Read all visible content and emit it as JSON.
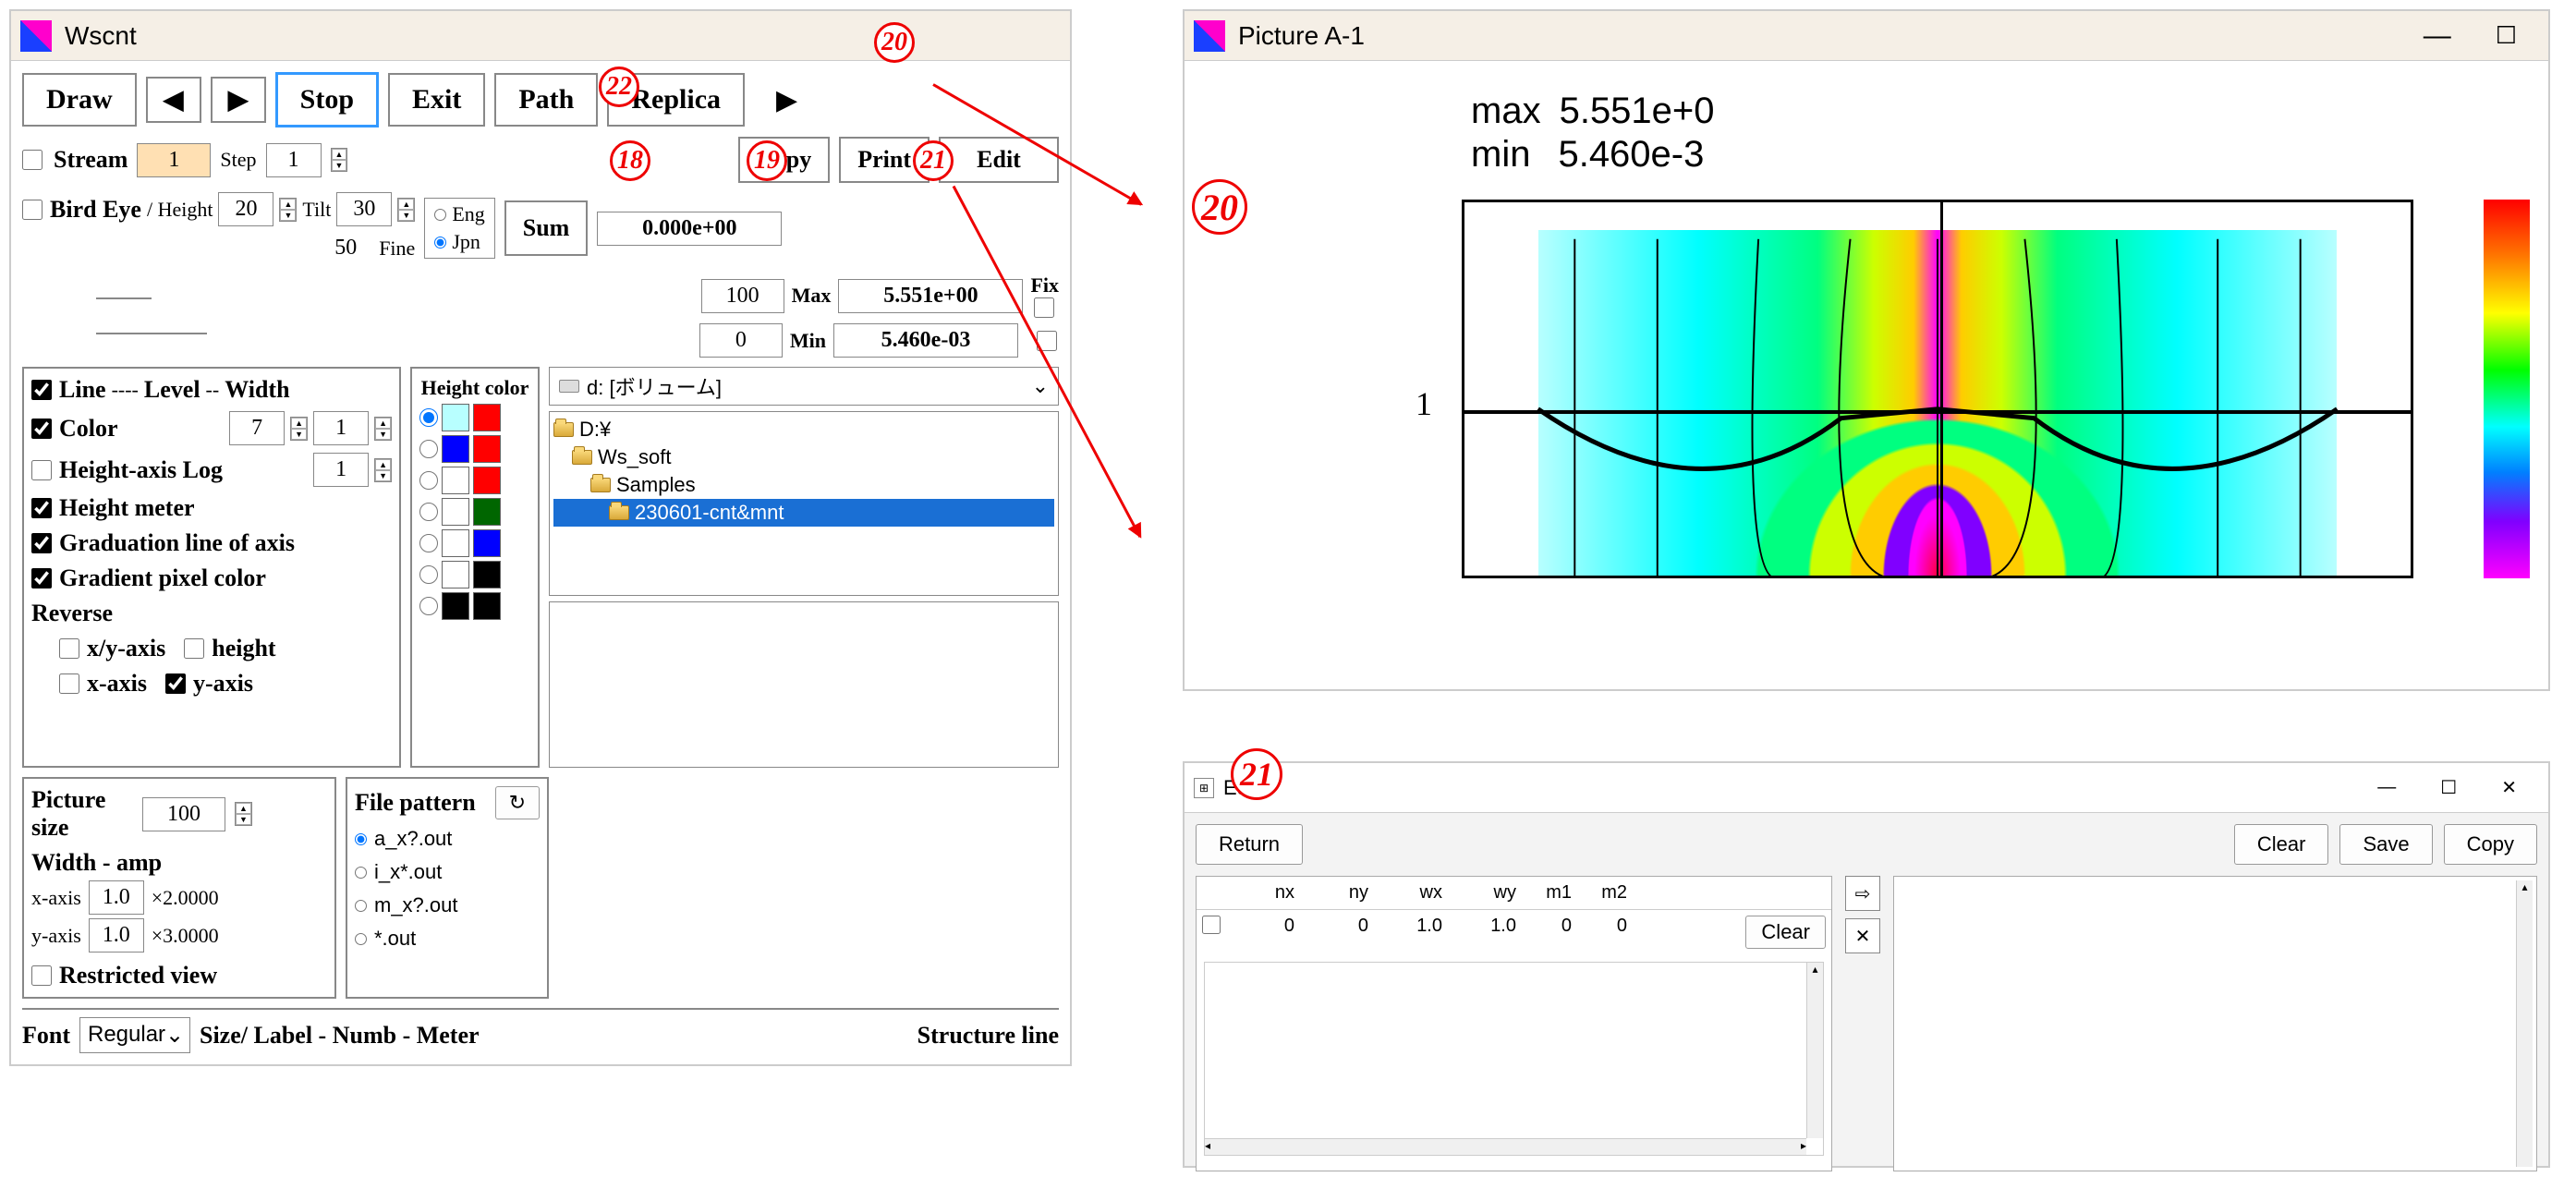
{
  "wscnt": {
    "title": "Wscnt",
    "toolbar1": {
      "draw": "Draw",
      "stop": "Stop",
      "exit": "Exit",
      "path": "Path",
      "replica": "Replica"
    },
    "toolbar2": {
      "copy": "Copy",
      "print": "Print",
      "edit": "Edit"
    },
    "stream": {
      "label": "Stream",
      "value": "1",
      "step_label": "Step",
      "step_value": "1"
    },
    "bird": {
      "label": "Bird Eye",
      "height_label": "/ Height",
      "height_value": "20",
      "tilt_label": "Tilt",
      "tilt_value": "30"
    },
    "fine": {
      "value": "50",
      "label": "Fine"
    },
    "lang": {
      "eng": "Eng",
      "jpn": "Jpn"
    },
    "sum": {
      "label": "Sum",
      "value": "0.000e+00"
    },
    "range": {
      "fix_label": "Fix",
      "max_scale": "100",
      "max_label": "Max",
      "max_value": "5.551e+00",
      "min_scale": "0",
      "min_label": "Min",
      "min_value": "5.460e-03"
    },
    "line_panel": {
      "line": "Line",
      "level": "Level",
      "width": "Width",
      "color": "Color",
      "color_val": "7",
      "color_w": "1",
      "height_axis_log": "Height-axis Log",
      "hal_val": "1",
      "height_meter": "Height meter",
      "grad_line": "Graduation line of axis",
      "grad_pixel": "Gradient pixel color",
      "reverse": "Reverse",
      "xy_axis": "x/y-axis",
      "height": "height",
      "x_axis": "x-axis",
      "y_axis": "y-axis"
    },
    "height_color": {
      "title": "Height color",
      "swatches": [
        [
          "#b8ffff",
          "#ff0000"
        ],
        [
          "#0000ff",
          "#ff0000"
        ],
        [
          "#ffffff",
          "#ff0000"
        ],
        [
          "#ffffff",
          "#006600"
        ],
        [
          "#ffffff",
          "#0000ff"
        ],
        [
          "#ffffff",
          "#000000"
        ],
        [
          "#000000",
          "#000000"
        ]
      ]
    },
    "dir": {
      "drive": "d: [ボリューム]",
      "tree": [
        "D:¥",
        "Ws_soft",
        "Samples",
        "230601-cnt&mnt"
      ]
    },
    "picture_size": {
      "label": "Picture size",
      "value": "100",
      "width_amp": "Width - amp",
      "x_axis_label": "x-axis",
      "x_axis_val": "1.0",
      "x_axis_mul": "×2.0000",
      "y_axis_label": "y-axis",
      "y_axis_val": "1.0",
      "y_axis_mul": "×3.0000",
      "restricted": "Restricted view"
    },
    "file_pattern": {
      "label": "File pattern",
      "opts": [
        "a_x?.out",
        "i_x*.out",
        "m_x?.out",
        "*.out"
      ]
    },
    "font_row": {
      "font_label": "Font",
      "font_val": "Regular",
      "size_label": "Size/ Label - Numb - Meter",
      "structure": "Structure line"
    }
  },
  "picture": {
    "title": "Picture A-1",
    "max_label": "max",
    "max_value": "5.551e+0",
    "min_label": "min",
    "min_value": "5.460e-3",
    "tick_y": "1"
  },
  "editwin": {
    "title": "Edit",
    "return": "Return",
    "clear": "Clear",
    "save": "Save",
    "copy": "Copy",
    "inner_clear": "Clear",
    "headers": [
      "nx",
      "ny",
      "wx",
      "wy",
      "m1",
      "m2"
    ],
    "row": [
      "0",
      "0",
      "1.0",
      "1.0",
      "0",
      "0"
    ]
  },
  "annotations": {
    "a18": "18",
    "a19": "19",
    "a20": "20",
    "a21": "21",
    "a22": "22"
  },
  "chart_data": {
    "type": "heatmap",
    "title": "Picture A-1",
    "value_range": {
      "max": 5.551,
      "min": 0.00546
    },
    "y_ticks": [
      1
    ],
    "colorscale": [
      "#ff0000",
      "#ff7800",
      "#ffff00",
      "#00ff00",
      "#00ffff",
      "#0080ff",
      "#8000ff",
      "#ff00ff"
    ],
    "notes": "2D contour/heatmap; symmetric field peaking at center column, overlaid black curve descending from y≈1 at edges toward center"
  }
}
